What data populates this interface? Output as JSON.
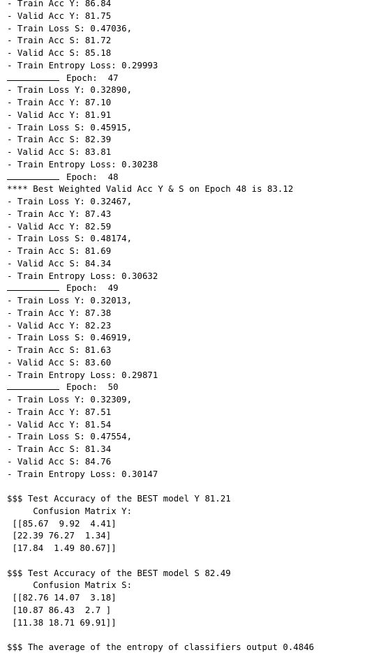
{
  "output": {
    "lines": [
      {
        "type": "text",
        "text": "- Train Acc Y: 86.84"
      },
      {
        "type": "text",
        "text": "- Valid Acc Y: 81.75"
      },
      {
        "type": "text",
        "text": "- Train Loss S: 0.47036,"
      },
      {
        "type": "text",
        "text": "- Train Acc S: 81.72"
      },
      {
        "type": "text",
        "text": "- Valid Acc S: 85.18"
      },
      {
        "type": "text",
        "text": "- Train Entropy Loss: 0.29993"
      },
      {
        "type": "epoch",
        "text": "Epoch:  47"
      },
      {
        "type": "text",
        "text": "- Train Loss Y: 0.32890,"
      },
      {
        "type": "text",
        "text": "- Train Acc Y: 87.10"
      },
      {
        "type": "text",
        "text": "- Valid Acc Y: 81.91"
      },
      {
        "type": "text",
        "text": "- Train Loss S: 0.45915,"
      },
      {
        "type": "text",
        "text": "- Train Acc S: 82.39"
      },
      {
        "type": "text",
        "text": "- Valid Acc S: 83.81"
      },
      {
        "type": "text",
        "text": "- Train Entropy Loss: 0.30238"
      },
      {
        "type": "epoch",
        "text": "Epoch:  48"
      },
      {
        "type": "text",
        "text": "**** Best Weighted Valid Acc Y & S on Epoch 48 is 83.12"
      },
      {
        "type": "text",
        "text": "- Train Loss Y: 0.32467,"
      },
      {
        "type": "text",
        "text": "- Train Acc Y: 87.43"
      },
      {
        "type": "text",
        "text": "- Valid Acc Y: 82.59"
      },
      {
        "type": "text",
        "text": "- Train Loss S: 0.48174,"
      },
      {
        "type": "text",
        "text": "- Train Acc S: 81.69"
      },
      {
        "type": "text",
        "text": "- Valid Acc S: 84.34"
      },
      {
        "type": "text",
        "text": "- Train Entropy Loss: 0.30632"
      },
      {
        "type": "epoch",
        "text": "Epoch:  49"
      },
      {
        "type": "text",
        "text": "- Train Loss Y: 0.32013,"
      },
      {
        "type": "text",
        "text": "- Train Acc Y: 87.38"
      },
      {
        "type": "text",
        "text": "- Valid Acc Y: 82.23"
      },
      {
        "type": "text",
        "text": "- Train Loss S: 0.46919,"
      },
      {
        "type": "text",
        "text": "- Train Acc S: 81.63"
      },
      {
        "type": "text",
        "text": "- Valid Acc S: 83.60"
      },
      {
        "type": "text",
        "text": "- Train Entropy Loss: 0.29871"
      },
      {
        "type": "epoch",
        "text": "Epoch:  50"
      },
      {
        "type": "text",
        "text": "- Train Loss Y: 0.32309,"
      },
      {
        "type": "text",
        "text": "- Train Acc Y: 87.51"
      },
      {
        "type": "text",
        "text": "- Valid Acc Y: 81.54"
      },
      {
        "type": "text",
        "text": "- Train Loss S: 0.47554,"
      },
      {
        "type": "text",
        "text": "- Train Acc S: 81.34"
      },
      {
        "type": "text",
        "text": "- Valid Acc S: 84.76"
      },
      {
        "type": "text",
        "text": "- Train Entropy Loss: 0.30147"
      },
      {
        "type": "blank",
        "text": ""
      },
      {
        "type": "text",
        "text": "$$$ Test Accuracy of the BEST model Y 81.21"
      },
      {
        "type": "text",
        "text": "     Confusion Matrix Y:"
      },
      {
        "type": "text",
        "text": " [[85.67  9.92  4.41]"
      },
      {
        "type": "text",
        "text": " [22.39 76.27  1.34]"
      },
      {
        "type": "text",
        "text": " [17.84  1.49 80.67]]"
      },
      {
        "type": "blank",
        "text": ""
      },
      {
        "type": "text",
        "text": "$$$ Test Accuracy of the BEST model S 82.49"
      },
      {
        "type": "text",
        "text": "     Confusion Matrix S:"
      },
      {
        "type": "text",
        "text": " [[82.76 14.07  3.18]"
      },
      {
        "type": "text",
        "text": " [10.87 86.43  2.7 ]"
      },
      {
        "type": "text",
        "text": " [11.38 18.71 69.91]]"
      },
      {
        "type": "blank",
        "text": ""
      },
      {
        "type": "text",
        "text": "$$$ The average of the entropy of classifiers output 0.4846"
      }
    ]
  }
}
